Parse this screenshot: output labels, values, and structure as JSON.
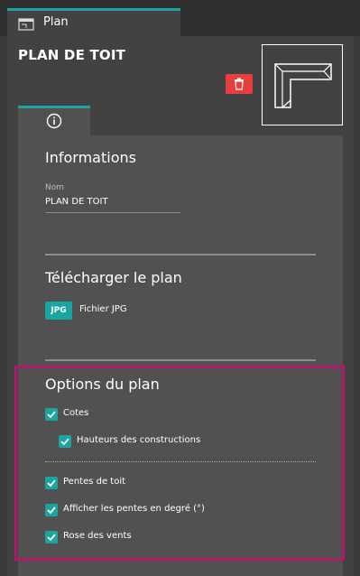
{
  "tab": {
    "label": "Plan",
    "icon": "plan-icon"
  },
  "header": {
    "title": "PLAN DE TOIT",
    "delete_icon": "trash-icon"
  },
  "subtab": {
    "icon": "info-icon"
  },
  "informations": {
    "title": "Informations",
    "name_label": "Nom",
    "name_value": "PLAN DE TOIT"
  },
  "download": {
    "title": "Télécharger le plan",
    "badge": "JPG",
    "label": "Fichier JPG"
  },
  "options": {
    "title": "Options du plan",
    "items": [
      {
        "label": "Cotes",
        "checked": true
      },
      {
        "label": "Hauteurs des constructions",
        "checked": true
      },
      {
        "label": "Pentes de toit",
        "checked": true
      },
      {
        "label": "Afficher les pentes en degré (°)",
        "checked": true
      },
      {
        "label": "Rose des vents",
        "checked": true
      }
    ]
  },
  "colors": {
    "accent": "#1aa5a2",
    "danger": "#e83e3e",
    "highlight": "#b0176d"
  }
}
